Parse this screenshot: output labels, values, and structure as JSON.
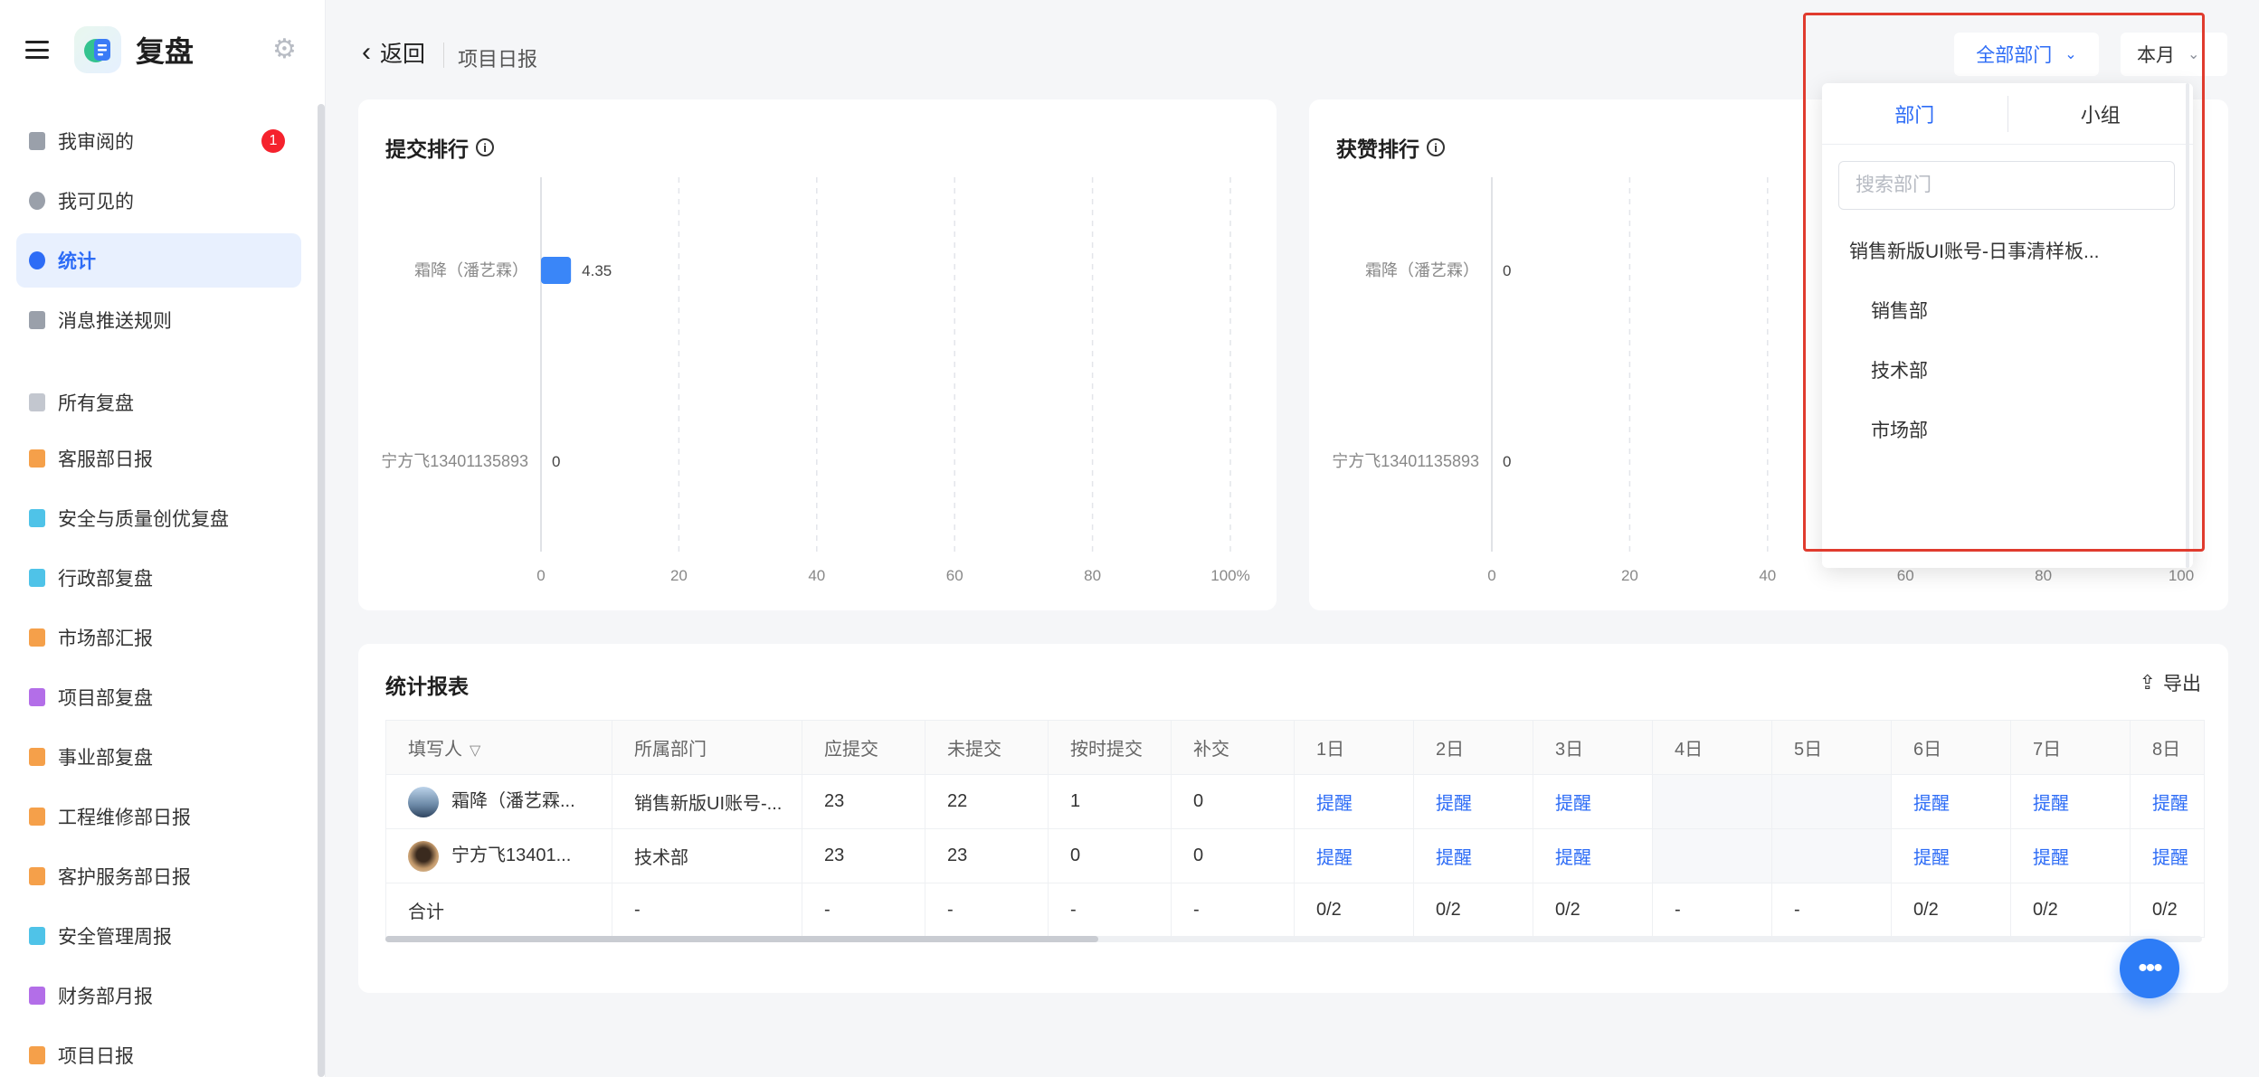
{
  "app": {
    "title": "复盘"
  },
  "sidebar": {
    "items": [
      {
        "label": "我审阅的",
        "badge": "1",
        "icon_color": "#9aa0aa"
      },
      {
        "label": "我可见的",
        "icon_color": "#9aa0aa"
      },
      {
        "label": "统计",
        "icon_color": "#2d6cf6"
      },
      {
        "label": "消息推送规则",
        "icon_color": "#9aa0aa"
      }
    ],
    "section_title": "所有复盘",
    "reports": [
      {
        "label": "客服部日报",
        "color": "#f5a04a"
      },
      {
        "label": "安全与质量创优复盘",
        "color": "#4fc3e8"
      },
      {
        "label": "行政部复盘",
        "color": "#4fc3e8"
      },
      {
        "label": "市场部汇报",
        "color": "#f5a04a"
      },
      {
        "label": "项目部复盘",
        "color": "#b36ee8"
      },
      {
        "label": "事业部复盘",
        "color": "#f5a04a"
      },
      {
        "label": "工程维修部日报",
        "color": "#f5a04a"
      },
      {
        "label": "客护服务部日报",
        "color": "#f5a04a"
      },
      {
        "label": "安全管理周报",
        "color": "#4fc3e8"
      },
      {
        "label": "财务部月报",
        "color": "#b36ee8"
      },
      {
        "label": "项目日报",
        "color": "#f5a04a"
      }
    ]
  },
  "topbar": {
    "back_label": "返回",
    "breadcrumb": "项目日报",
    "dept_filter": "全部部门",
    "period_filter": "本月"
  },
  "charts": {
    "submit": {
      "title": "提交排行",
      "chart_data": {
        "type": "bar",
        "orientation": "horizontal",
        "title": "提交排行",
        "categories": [
          "霜降（潘艺霖）",
          "宁方飞13401135893"
        ],
        "values": [
          4.35,
          0
        ],
        "data_labels": [
          "4.35",
          "0"
        ],
        "xlim": [
          0,
          100
        ],
        "x_ticks": [
          "0",
          "20",
          "40",
          "60",
          "80",
          "100%"
        ],
        "grid": true,
        "bar_color": "#3a86f8"
      }
    },
    "likes": {
      "title": "获赞排行",
      "chart_data": {
        "type": "bar",
        "orientation": "horizontal",
        "title": "获赞排行",
        "categories": [
          "霜降（潘艺霖）",
          "宁方飞13401135893"
        ],
        "values": [
          0,
          0
        ],
        "data_labels": [
          "0",
          "0"
        ],
        "xlim": [
          0,
          100
        ],
        "x_ticks": [
          "0",
          "20",
          "40",
          "60",
          "80",
          "100"
        ],
        "grid": true,
        "bar_color": "#3a86f8"
      }
    }
  },
  "report": {
    "title": "统计报表",
    "export_label": "导出",
    "columns": [
      "填写人",
      "所属部门",
      "应提交",
      "未提交",
      "按时提交",
      "补交",
      "1日",
      "2日",
      "3日",
      "4日",
      "5日",
      "6日",
      "7日",
      "8日"
    ],
    "rows": [
      {
        "name": "霜降（潘艺霖...",
        "dept": "销售新版UI账号-...",
        "due": "23",
        "missing": "22",
        "ontime": "1",
        "late": "0",
        "days": [
          "提醒",
          "提醒",
          "提醒",
          "",
          "",
          "提醒",
          "提醒",
          "提醒"
        ]
      },
      {
        "name": "宁方飞13401...",
        "dept": "技术部",
        "due": "23",
        "missing": "23",
        "ontime": "0",
        "late": "0",
        "days": [
          "提醒",
          "提醒",
          "提醒",
          "",
          "",
          "提醒",
          "提醒",
          "提醒"
        ]
      },
      {
        "name": "合计",
        "dept": "-",
        "due": "-",
        "missing": "-",
        "ontime": "-",
        "late": "-",
        "days": [
          "0/2",
          "0/2",
          "0/2",
          "-",
          "-",
          "0/2",
          "0/2",
          "0/2"
        ]
      }
    ]
  },
  "dropdown": {
    "tabs": [
      "部门",
      "小组"
    ],
    "search_placeholder": "搜索部门",
    "items": [
      {
        "label": "销售新版UI账号-日事清样板..."
      },
      {
        "label": "销售部"
      },
      {
        "label": "技术部"
      },
      {
        "label": "市场部"
      }
    ]
  },
  "colors": {
    "accent": "#2d6cf6",
    "highlight": "#e03b2e"
  }
}
